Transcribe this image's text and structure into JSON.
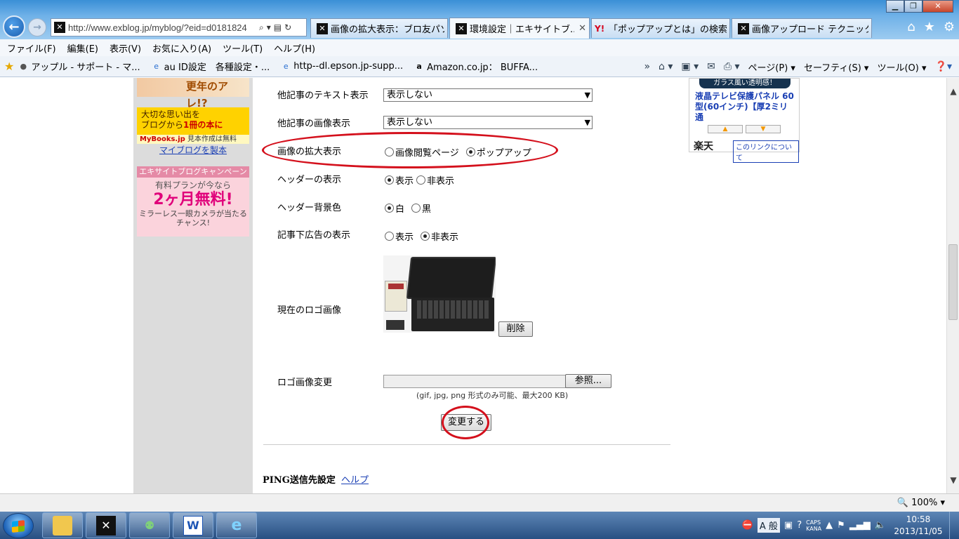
{
  "browser": {
    "url": "http://www.exblog.jp/myblog/?eid=d0181824",
    "tabs": [
      {
        "label": "画像の拡大表示：ブロ友パソ..."
      },
      {
        "label": "環境設定｜エキサイトブ...",
        "active": true
      },
      {
        "label": "「ポップアップとは」の検索..."
      },
      {
        "label": "画像アップロード テクニック..."
      }
    ]
  },
  "menu": [
    "ファイル(F)",
    "編集(E)",
    "表示(V)",
    "お気に入り(A)",
    "ツール(T)",
    "ヘルプ(H)"
  ],
  "favorites": [
    {
      "label": "アップル - サポート - マ..."
    },
    {
      "label": "au ID設定　各種設定・..."
    },
    {
      "label": "http--dl.epson.jp-supp..."
    },
    {
      "label": "Amazon.co.jp： BUFFA..."
    }
  ],
  "command_bar": {
    "page": "ページ(P)",
    "safety": "セーフティ(S)",
    "tools": "ツール(O)"
  },
  "sidebar": {
    "banner1_text": "更年のアレ!?",
    "banner2_line1": "大切な思い出を",
    "banner2_line2": "ブログから",
    "banner2_highlight": "1冊の本に",
    "banner2_brand": "MyBooks.jp",
    "banner2_note": "見本作成は無料",
    "mybooks_link": "マイブログを製本",
    "banner3_top": "エキサイトブログキャンペーン",
    "banner3_mid": "有料プランが今なら",
    "banner3_big": "2ヶ月無料!",
    "banner3_bottom": "ミラーレス一眼カメラが当たるチャンス!"
  },
  "settings": {
    "other_text_label": "他記事のテキスト表示",
    "other_text_value": "表示しない",
    "other_image_label": "他記事の画像表示",
    "other_image_value": "表示しない",
    "zoom_label": "画像の拡大表示",
    "zoom_opt1": "画像閲覧ページ",
    "zoom_opt2": "ポップアップ",
    "header_label": "ヘッダーの表示",
    "header_opt1": "表示",
    "header_opt2": "非表示",
    "header_bg_label": "ヘッダー背景色",
    "header_bg_opt1": "白",
    "header_bg_opt2": "黒",
    "ad_label": "記事下広告の表示",
    "ad_opt1": "表示",
    "ad_opt2": "非表示",
    "logo_label": "現在のロゴ画像",
    "delete_button": "削除",
    "logo_change_label": "ロゴ画像変更",
    "browse_button": "参照...",
    "file_note": "(gif, jpg, png 形式のみ可能、最大200 KB)",
    "submit_button": "変更する",
    "ping_label": "PING送信先設定",
    "help_link": "ヘルプ"
  },
  "right_ad": {
    "image_caption": "ガラス風い透明感！",
    "text": "液晶テレビ保護パネル 60型(60インチ)【厚2ミリ通",
    "brand": "楽天",
    "link": "このリンクについて"
  },
  "status": {
    "zoom": "100%"
  },
  "taskbar": {
    "time": "10:58",
    "date": "2013/11/05",
    "ime": "A 般",
    "caps": "CAPS",
    "kana": "KANA"
  },
  "colors": {
    "annotation_red": "#d4101c",
    "link_blue": "#1a3fb4"
  }
}
